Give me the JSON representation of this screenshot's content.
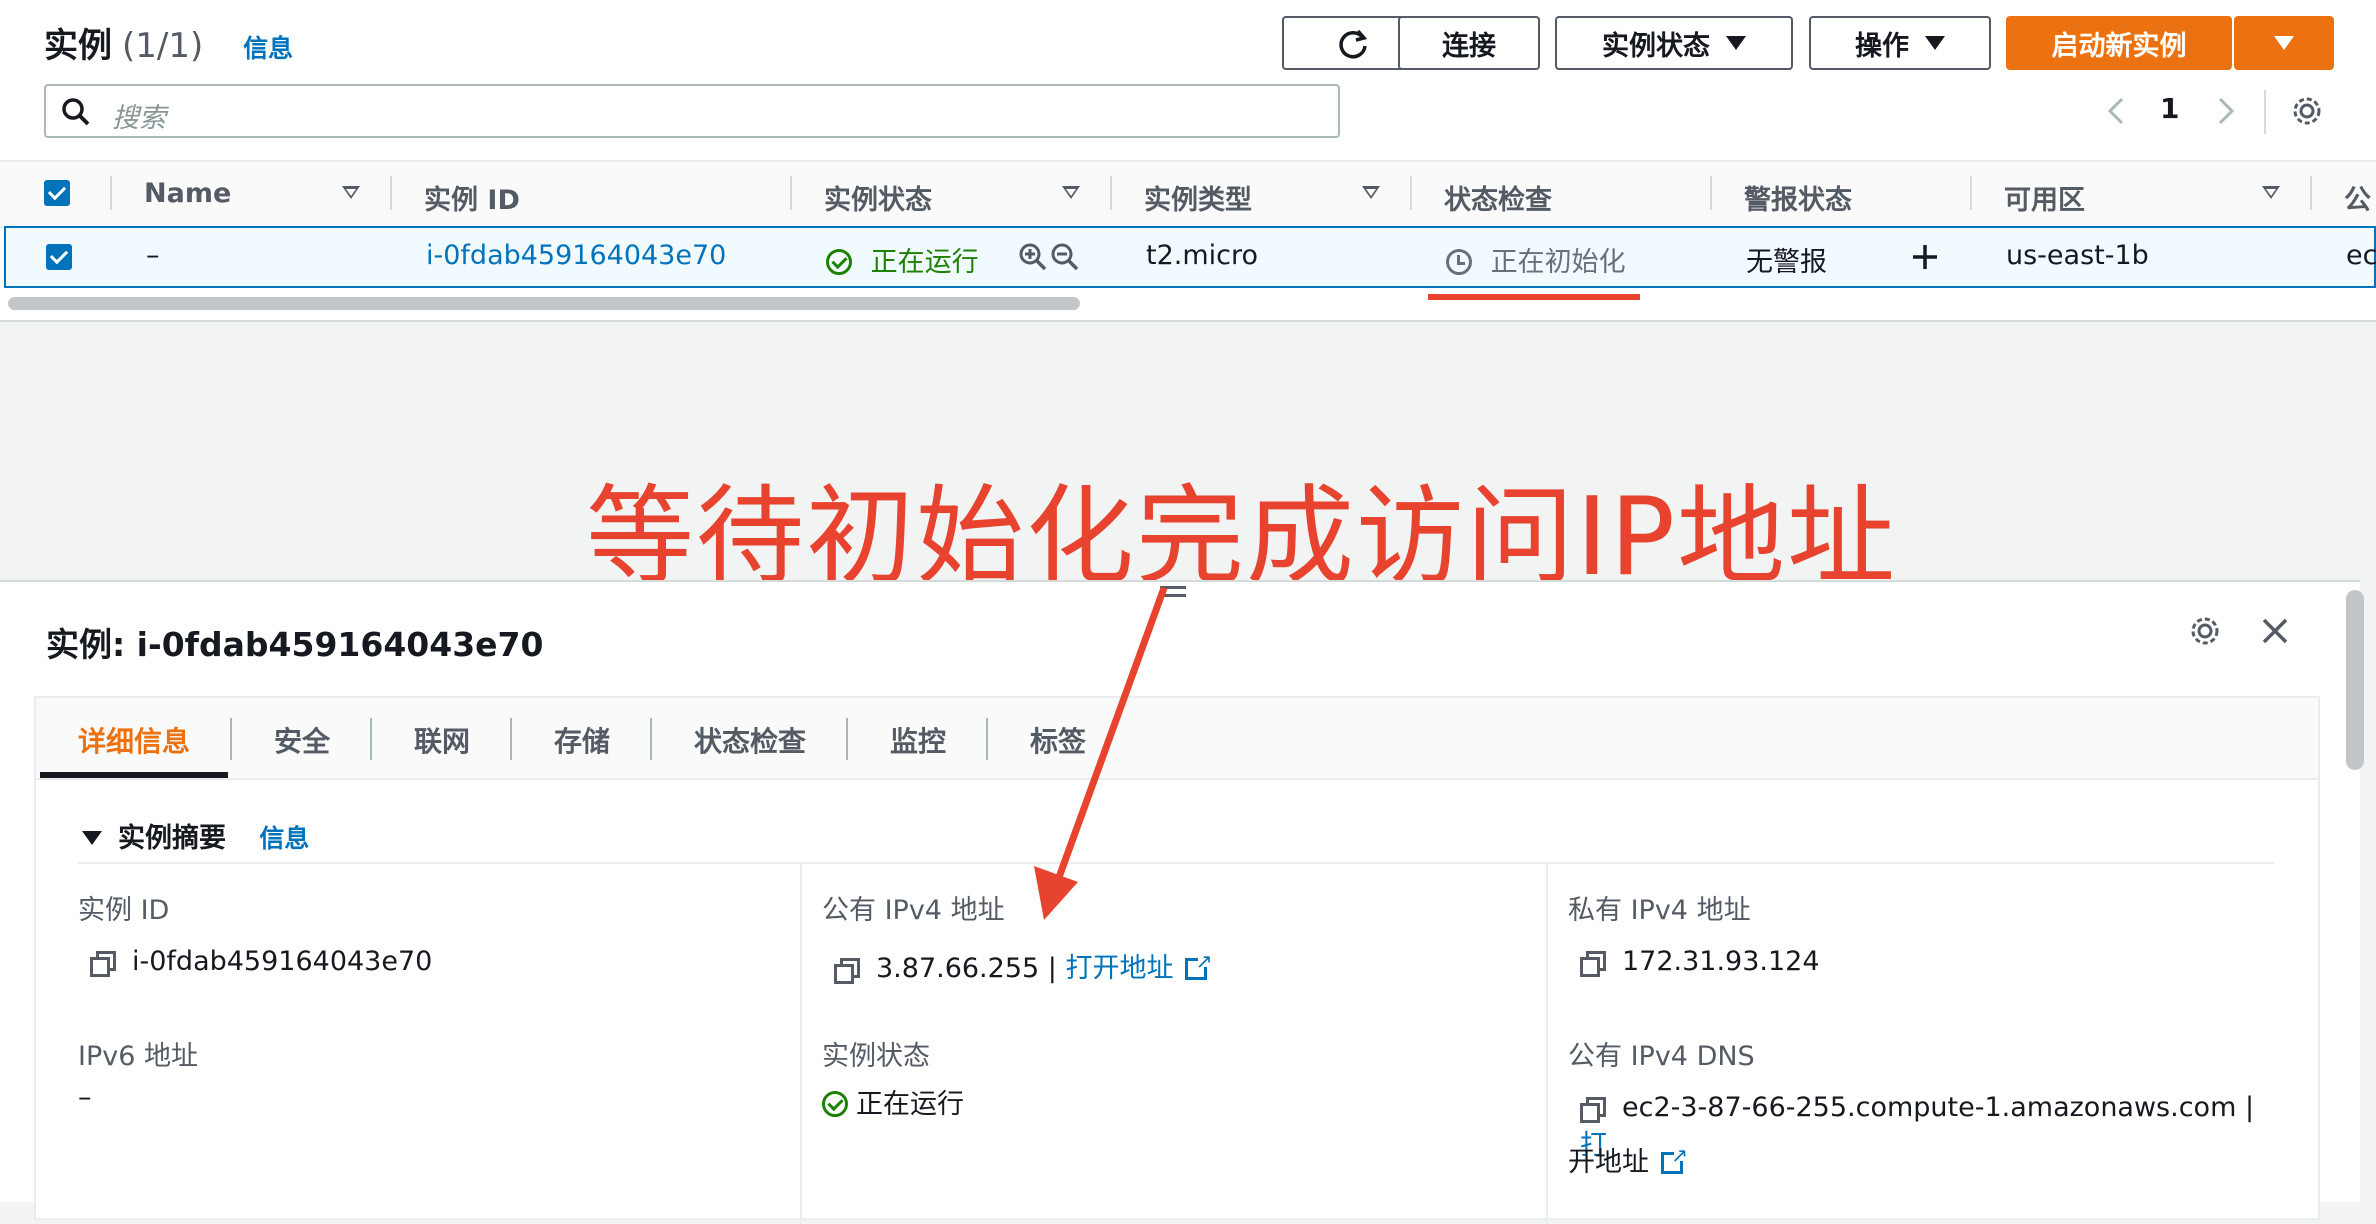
{
  "header": {
    "title": "实例",
    "count": "(1/1)",
    "info_link": "信息",
    "refresh_icon": "refresh-icon",
    "buttons": {
      "connect": "连接",
      "instance_state": "实例状态",
      "actions": "操作",
      "launch": "启动新实例"
    },
    "search_placeholder": "搜索",
    "page_number": "1"
  },
  "table": {
    "columns": [
      "Name",
      "实例 ID",
      "实例状态",
      "实例类型",
      "状态检查",
      "警报状态",
      "可用区",
      "公"
    ],
    "row": {
      "name": "–",
      "instance_id": "i-0fdab459164043e70",
      "state": "正在运行",
      "type": "t2.micro",
      "status_check": "正在初始化",
      "alarm": "无警报",
      "az": "us-east-1b",
      "public_dns_partial": "ec"
    }
  },
  "annotation": {
    "text": "等待初始化完成访问IP地址",
    "color": "#e8432f"
  },
  "detail": {
    "title": "实例: i-0fdab459164043e70",
    "tabs": [
      "详细信息",
      "安全",
      "联网",
      "存储",
      "状态检查",
      "监控",
      "标签"
    ],
    "section_title": "实例摘要",
    "section_info": "信息",
    "fields": {
      "instance_id_label": "实例 ID",
      "instance_id_value": "i-0fdab459164043e70",
      "public_ipv4_label": "公有 IPv4 地址",
      "public_ipv4_value": "3.87.66.255",
      "open_address": "打开地址",
      "private_ipv4_label": "私有 IPv4 地址",
      "private_ipv4_value": "172.31.93.124",
      "ipv6_label": "IPv6 地址",
      "ipv6_value": "–",
      "state_label": "实例状态",
      "state_value": "正在运行",
      "public_dns_label": "公有 IPv4 DNS",
      "public_dns_value": "ec2-3-87-66-255.compute-1.amazonaws.com",
      "open_address_part1": "打",
      "open_address_part2": "开地址"
    }
  },
  "colors": {
    "accent": "#ec7211",
    "link": "#0073bb",
    "success": "#1d8102"
  }
}
